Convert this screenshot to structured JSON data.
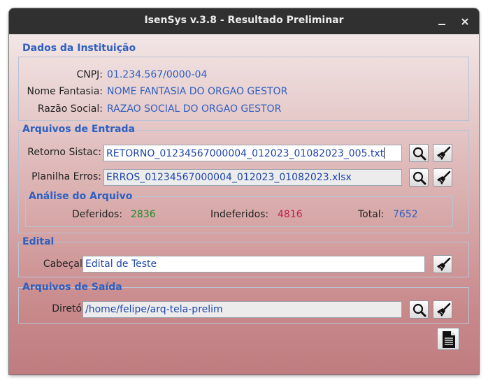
{
  "window": {
    "title": "IsenSys v.3.8 - Resultado Preliminar"
  },
  "titlebar": {
    "minimize_icon": "minimize-icon",
    "close_icon": "close-icon"
  },
  "instituicao": {
    "legend": "Dados da Instituição",
    "cnpj_label": "CNPJ:",
    "cnpj_value": "01.234.567/0000-04",
    "fantasia_label": "Nome Fantasia:",
    "fantasia_value": "NOME FANTASIA DO ORGAO GESTOR",
    "razao_label": "Razão Social:",
    "razao_value": "RAZAO SOCIAL DO ORGAO GESTOR"
  },
  "entrada": {
    "legend": "Arquivos de Entrada",
    "retorno_label": "Retorno Sistac:",
    "retorno_value": "RETORNO_01234567000004_012023_01082023_005.txt",
    "planilha_label": "Planilha Erros:",
    "planilha_value": "ERROS_01234567000004_012023_01082023.xlsx"
  },
  "analise": {
    "legend": "Análise do Arquivo",
    "deferidos_label": "Deferidos:",
    "deferidos_value": "2836",
    "indeferidos_label": "Indeferidos:",
    "indeferidos_value": "4816",
    "total_label": "Total:",
    "total_value": "7652",
    "colors": {
      "deferidos": "#1e8a2a",
      "indeferidos": "#c0204a",
      "total": "#2f5fbf"
    }
  },
  "edital": {
    "legend": "Edital",
    "cabecalho_label": "Cabeçalho:",
    "cabecalho_value": "Edital de Teste"
  },
  "saida": {
    "legend": "Arquivos de Saída",
    "diretorio_label": "Diretório:",
    "diretorio_value": "/home/felipe/arq-tela-prelim"
  },
  "icons": {
    "search": "search-icon",
    "clear": "broom-icon",
    "report": "document-icon"
  },
  "colors": {
    "accent": "#2f5fbf",
    "titlebar": "#303030"
  }
}
